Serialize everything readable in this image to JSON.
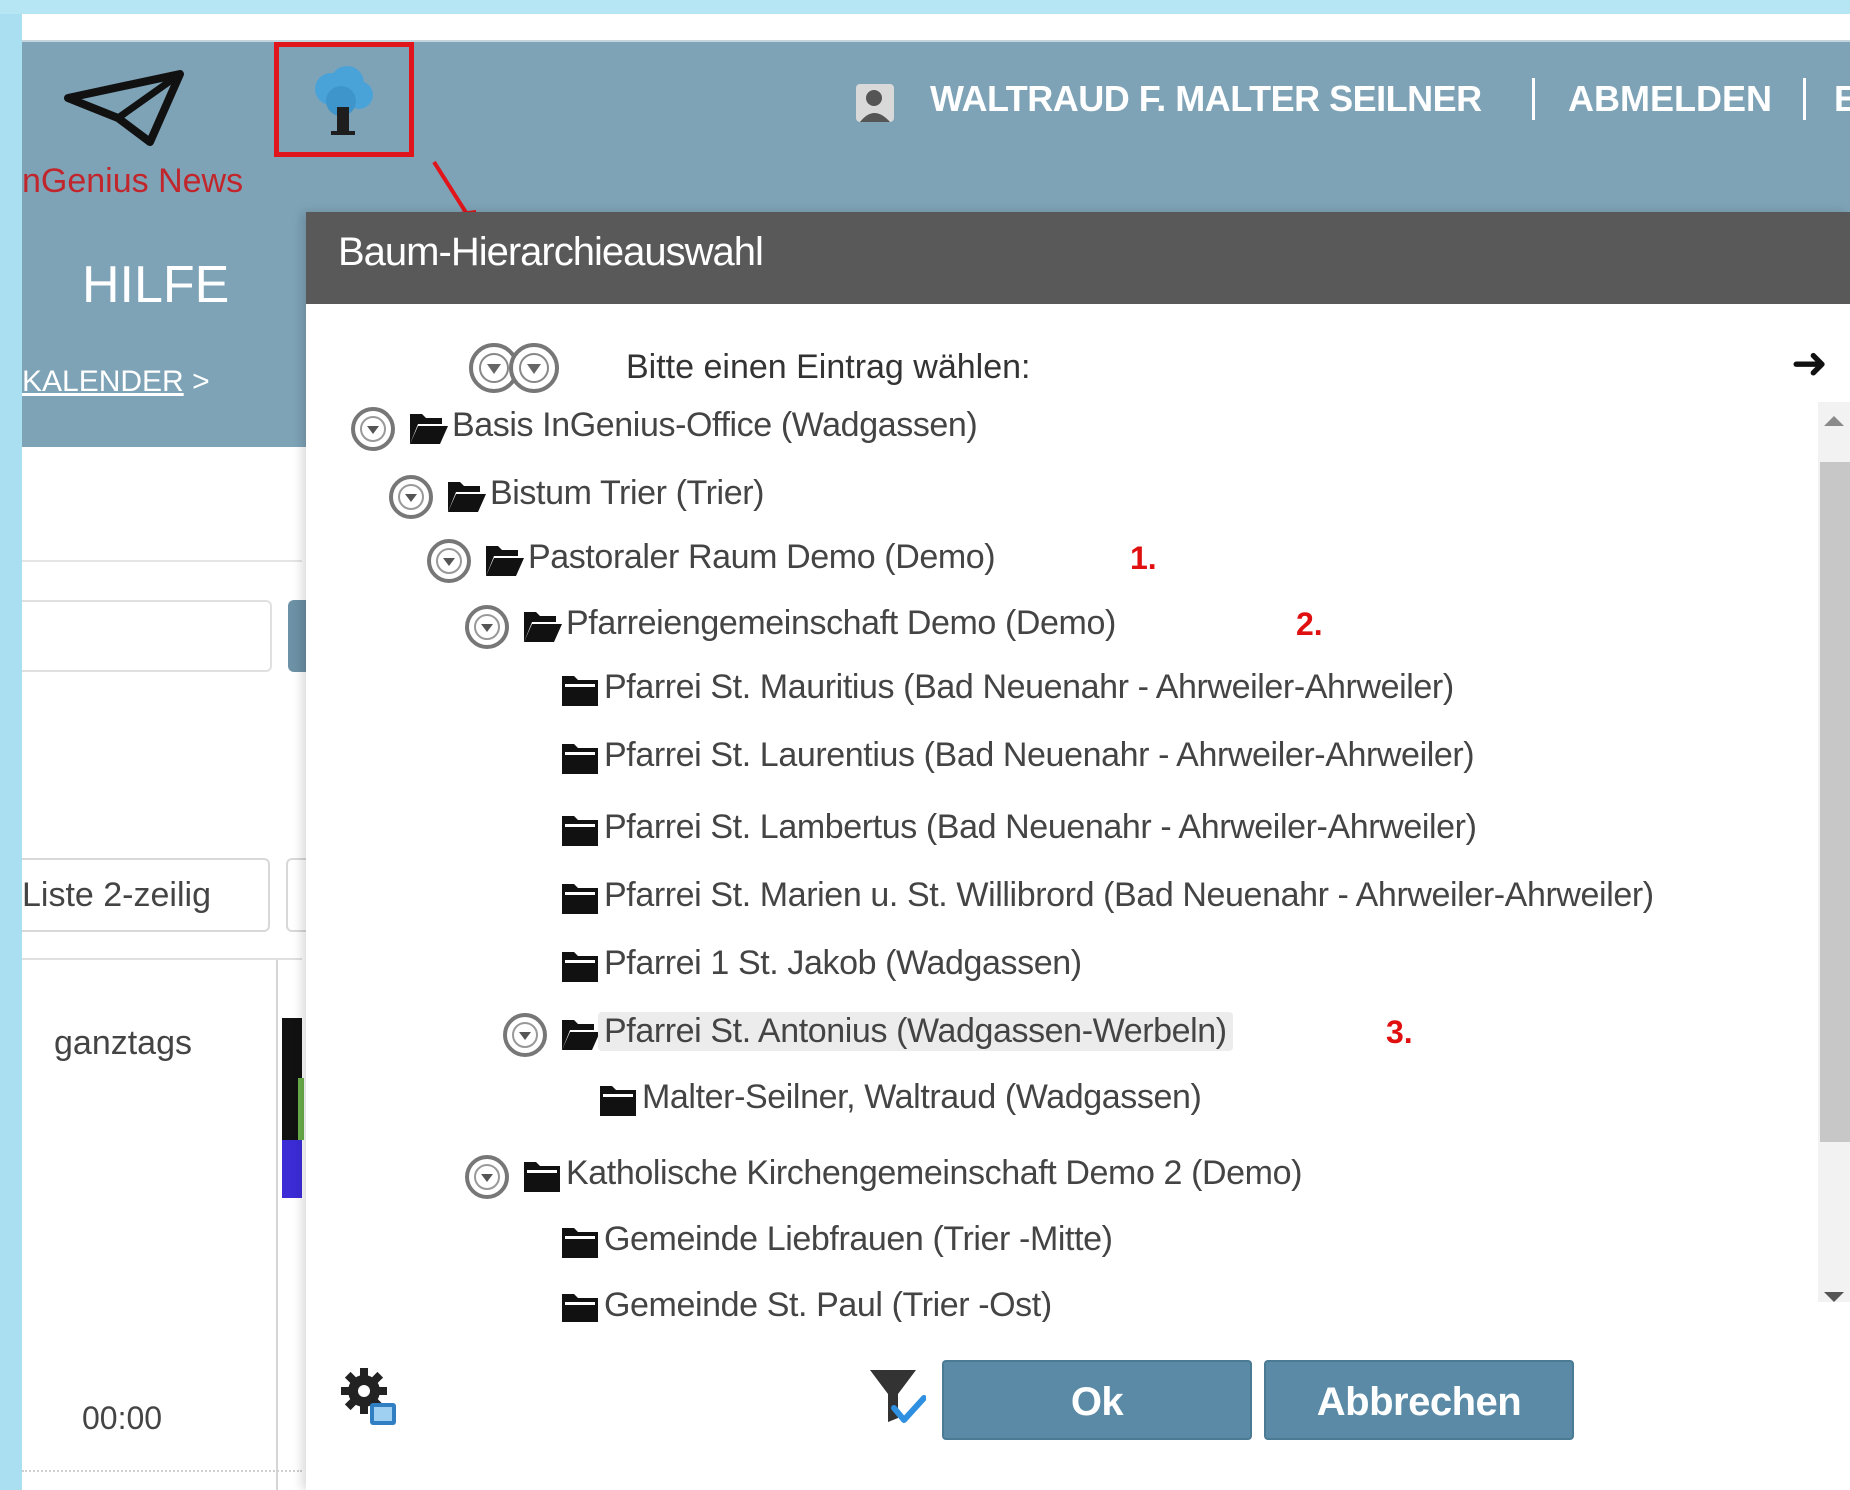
{
  "app": {
    "logo_text": "nGenius News",
    "tree_button_icon": "tree-icon",
    "user_name": "WALTRAUD F. MALTER SEILNER",
    "logout_label": "ABMELDEN",
    "truncated_item": "E",
    "menu_hilfe": "HILFE",
    "breadcrumb_kalender": "KALENDER",
    "breadcrumb_sep": ">"
  },
  "background": {
    "view_button": "Liste 2-zeilig",
    "allday_label": "ganztags",
    "time_label": "00:00"
  },
  "dialog": {
    "title": "Baum-Hierarchieauswahl",
    "prompt": "Bitte einen Eintrag wählen:",
    "go_arrow": "➜",
    "ok_label": "Ok",
    "cancel_label": "Abbrechen",
    "tree": [
      {
        "label": "Basis InGenius-Office (Wadgassen)",
        "level": 0,
        "expander": true,
        "open": true
      },
      {
        "label": "Bistum Trier (Trier)",
        "level": 1,
        "expander": true,
        "open": true
      },
      {
        "label": "Pastoraler Raum Demo (Demo)",
        "level": 2,
        "expander": true,
        "open": true,
        "marker": "1."
      },
      {
        "label": "Pfarreiengemeinschaft Demo (Demo)",
        "level": 3,
        "expander": true,
        "open": true,
        "marker": "2."
      },
      {
        "label": "Pfarrei St. Mauritius (Bad Neuenahr - Ahrweiler-Ahrweiler)",
        "level": 4,
        "expander": false,
        "open": false
      },
      {
        "label": "Pfarrei St. Laurentius (Bad Neuenahr - Ahrweiler-Ahrweiler)",
        "level": 4,
        "expander": false,
        "open": false
      },
      {
        "label": "Pfarrei St. Lambertus (Bad Neuenahr - Ahrweiler-Ahrweiler)",
        "level": 4,
        "expander": false,
        "open": false
      },
      {
        "label": "Pfarrei St. Marien u. St. Willibrord (Bad Neuenahr - Ahrweiler-Ahrweiler)",
        "level": 4,
        "expander": false,
        "open": false
      },
      {
        "label": "Pfarrei 1 St. Jakob (Wadgassen)",
        "level": 4,
        "expander": false,
        "open": false
      },
      {
        "label": "Pfarrei St. Antonius (Wadgassen-Werbeln)",
        "level": 4,
        "expander": true,
        "open": true,
        "selected": true,
        "marker": "3."
      },
      {
        "label": "Malter-Seilner, Waltraud (Wadgassen)",
        "level": 5,
        "expander": false,
        "open": false
      },
      {
        "label": "Katholische Kirchengemeinschaft Demo 2 (Demo)",
        "level": 3,
        "expander": true,
        "open": false
      },
      {
        "label": "Gemeinde Liebfrauen (Trier -Mitte)",
        "level": 4,
        "expander": false,
        "open": false
      },
      {
        "label": "Gemeinde St. Paul (Trier -Ost)",
        "level": 4,
        "expander": false,
        "open": false
      }
    ]
  },
  "colors": {
    "header": "#7ea3b7",
    "dialog_title": "#595959",
    "button": "#5a8aa6",
    "marker_red": "#e01010",
    "highlight_border": "#e0151b"
  }
}
